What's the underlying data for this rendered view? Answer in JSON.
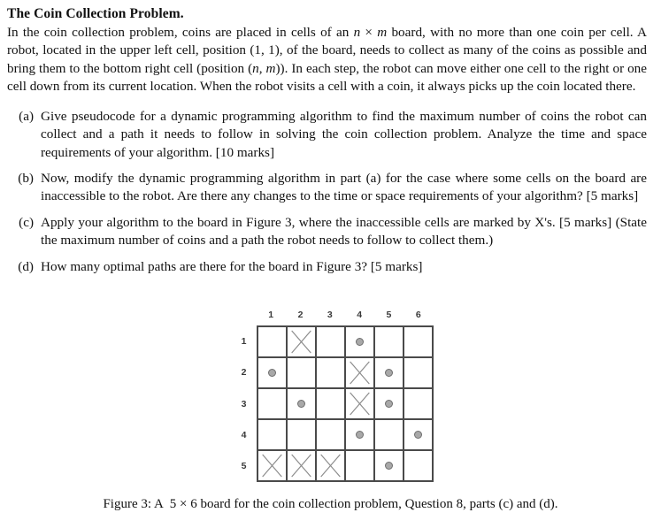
{
  "document": {
    "title": "The Coin Collection Problem.",
    "intro": {
      "line1": "In the coin collection problem, coins are placed in cells of an ",
      "var_n": "n",
      "times1": " × ",
      "var_m": "m",
      "line2": " board, with no more than one coin per cell. A robot, located in the upper left cell, position (1, 1), of the board, needs to collect as many of the coins as possible and bring them to the bottom right cell (position (",
      "var_n2": "n",
      "comma": ", ",
      "var_m2": "m",
      "line3": ")). In each step, the robot can move either one cell to the right or one cell down from its current location. When the robot visits a cell with a coin, it always picks up the coin located there."
    },
    "questions": [
      {
        "marker": "(a)",
        "text": "Give pseudocode for a dynamic programming algorithm to find the maximum number of coins the robot can collect and a path it needs to follow in solving the coin collection problem. Analyze the time and space requirements of your algorithm. [10 marks]"
      },
      {
        "marker": "(b)",
        "text": "Now, modify the dynamic programming algorithm in part (a) for the case where some cells on the board are inaccessible to the robot. Are there any changes to the time or space requirements of your algorithm? [5 marks]"
      },
      {
        "marker": "(c)",
        "text": "Apply your algorithm to the board in Figure 3, where the inaccessible cells are marked by X's. [5 marks] (State the maximum number of coins and a path the robot needs to follow to collect them.)"
      },
      {
        "marker": "(d)",
        "text": "How many optimal paths are there for the board in Figure 3? [5 marks]"
      }
    ]
  },
  "figure": {
    "caption_prefix": "Figure 3: A",
    "caption_dims": "5 × 6",
    "caption_rest": "board for the coin collection problem, Question 8, parts (c) and (d).",
    "column_headers": [
      "1",
      "2",
      "3",
      "4",
      "5",
      "6"
    ],
    "row_headers": [
      "1",
      "2",
      "3",
      "4",
      "5"
    ],
    "rows": 5,
    "cols": 6,
    "legend": {
      "coin_symbol": "coin-circle",
      "blocked_symbol": "x-mark"
    },
    "colors": {
      "grid_line": "#4a4a4a",
      "coin_fill": "#a8a8a8",
      "coin_stroke": "#6e6e6e",
      "x_stroke": "#8a8a8a",
      "header_text": "#3a3a3a"
    },
    "cells": [
      [
        {
          "row": 1,
          "col": 1,
          "content": ""
        },
        {
          "row": 1,
          "col": 2,
          "content": "x"
        },
        {
          "row": 1,
          "col": 3,
          "content": ""
        },
        {
          "row": 1,
          "col": 4,
          "content": "coin"
        },
        {
          "row": 1,
          "col": 5,
          "content": ""
        },
        {
          "row": 1,
          "col": 6,
          "content": ""
        }
      ],
      [
        {
          "row": 2,
          "col": 1,
          "content": "coin"
        },
        {
          "row": 2,
          "col": 2,
          "content": ""
        },
        {
          "row": 2,
          "col": 3,
          "content": ""
        },
        {
          "row": 2,
          "col": 4,
          "content": "x"
        },
        {
          "row": 2,
          "col": 5,
          "content": "coin"
        },
        {
          "row": 2,
          "col": 6,
          "content": ""
        }
      ],
      [
        {
          "row": 3,
          "col": 1,
          "content": ""
        },
        {
          "row": 3,
          "col": 2,
          "content": "coin"
        },
        {
          "row": 3,
          "col": 3,
          "content": ""
        },
        {
          "row": 3,
          "col": 4,
          "content": "x"
        },
        {
          "row": 3,
          "col": 5,
          "content": "coin"
        },
        {
          "row": 3,
          "col": 6,
          "content": ""
        }
      ],
      [
        {
          "row": 4,
          "col": 1,
          "content": ""
        },
        {
          "row": 4,
          "col": 2,
          "content": ""
        },
        {
          "row": 4,
          "col": 3,
          "content": ""
        },
        {
          "row": 4,
          "col": 4,
          "content": "coin"
        },
        {
          "row": 4,
          "col": 5,
          "content": ""
        },
        {
          "row": 4,
          "col": 6,
          "content": "coin"
        }
      ],
      [
        {
          "row": 5,
          "col": 1,
          "content": "x"
        },
        {
          "row": 5,
          "col": 2,
          "content": "x"
        },
        {
          "row": 5,
          "col": 3,
          "content": "x"
        },
        {
          "row": 5,
          "col": 4,
          "content": ""
        },
        {
          "row": 5,
          "col": 5,
          "content": "coin"
        },
        {
          "row": 5,
          "col": 6,
          "content": ""
        }
      ]
    ]
  }
}
